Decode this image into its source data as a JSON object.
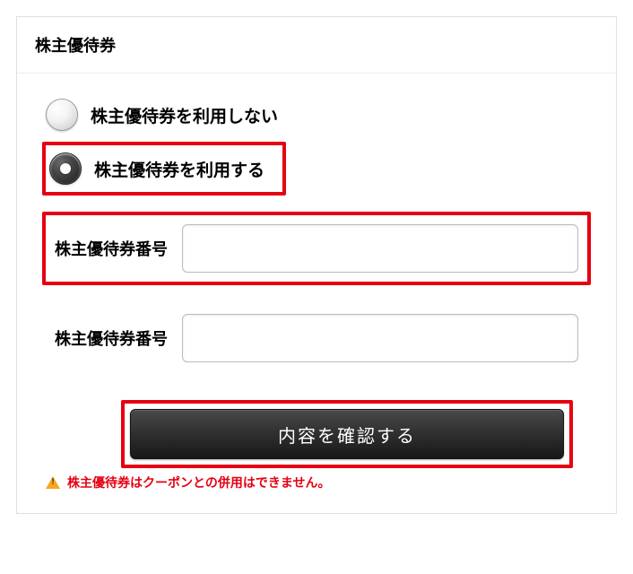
{
  "section": {
    "title": "株主優待券"
  },
  "options": {
    "not_use": "株主優待券を利用しない",
    "use": "株主優待券を利用する"
  },
  "fields": {
    "ticket_number_label": "株主優待券番号",
    "ticket_number_value_1": "",
    "ticket_number_value_2": ""
  },
  "actions": {
    "confirm_label": "内容を確認する"
  },
  "notes": {
    "warning": "株主優待券はクーポンとの併用はできません。"
  },
  "highlights": {
    "use_option": true,
    "first_field": true,
    "submit": true
  }
}
